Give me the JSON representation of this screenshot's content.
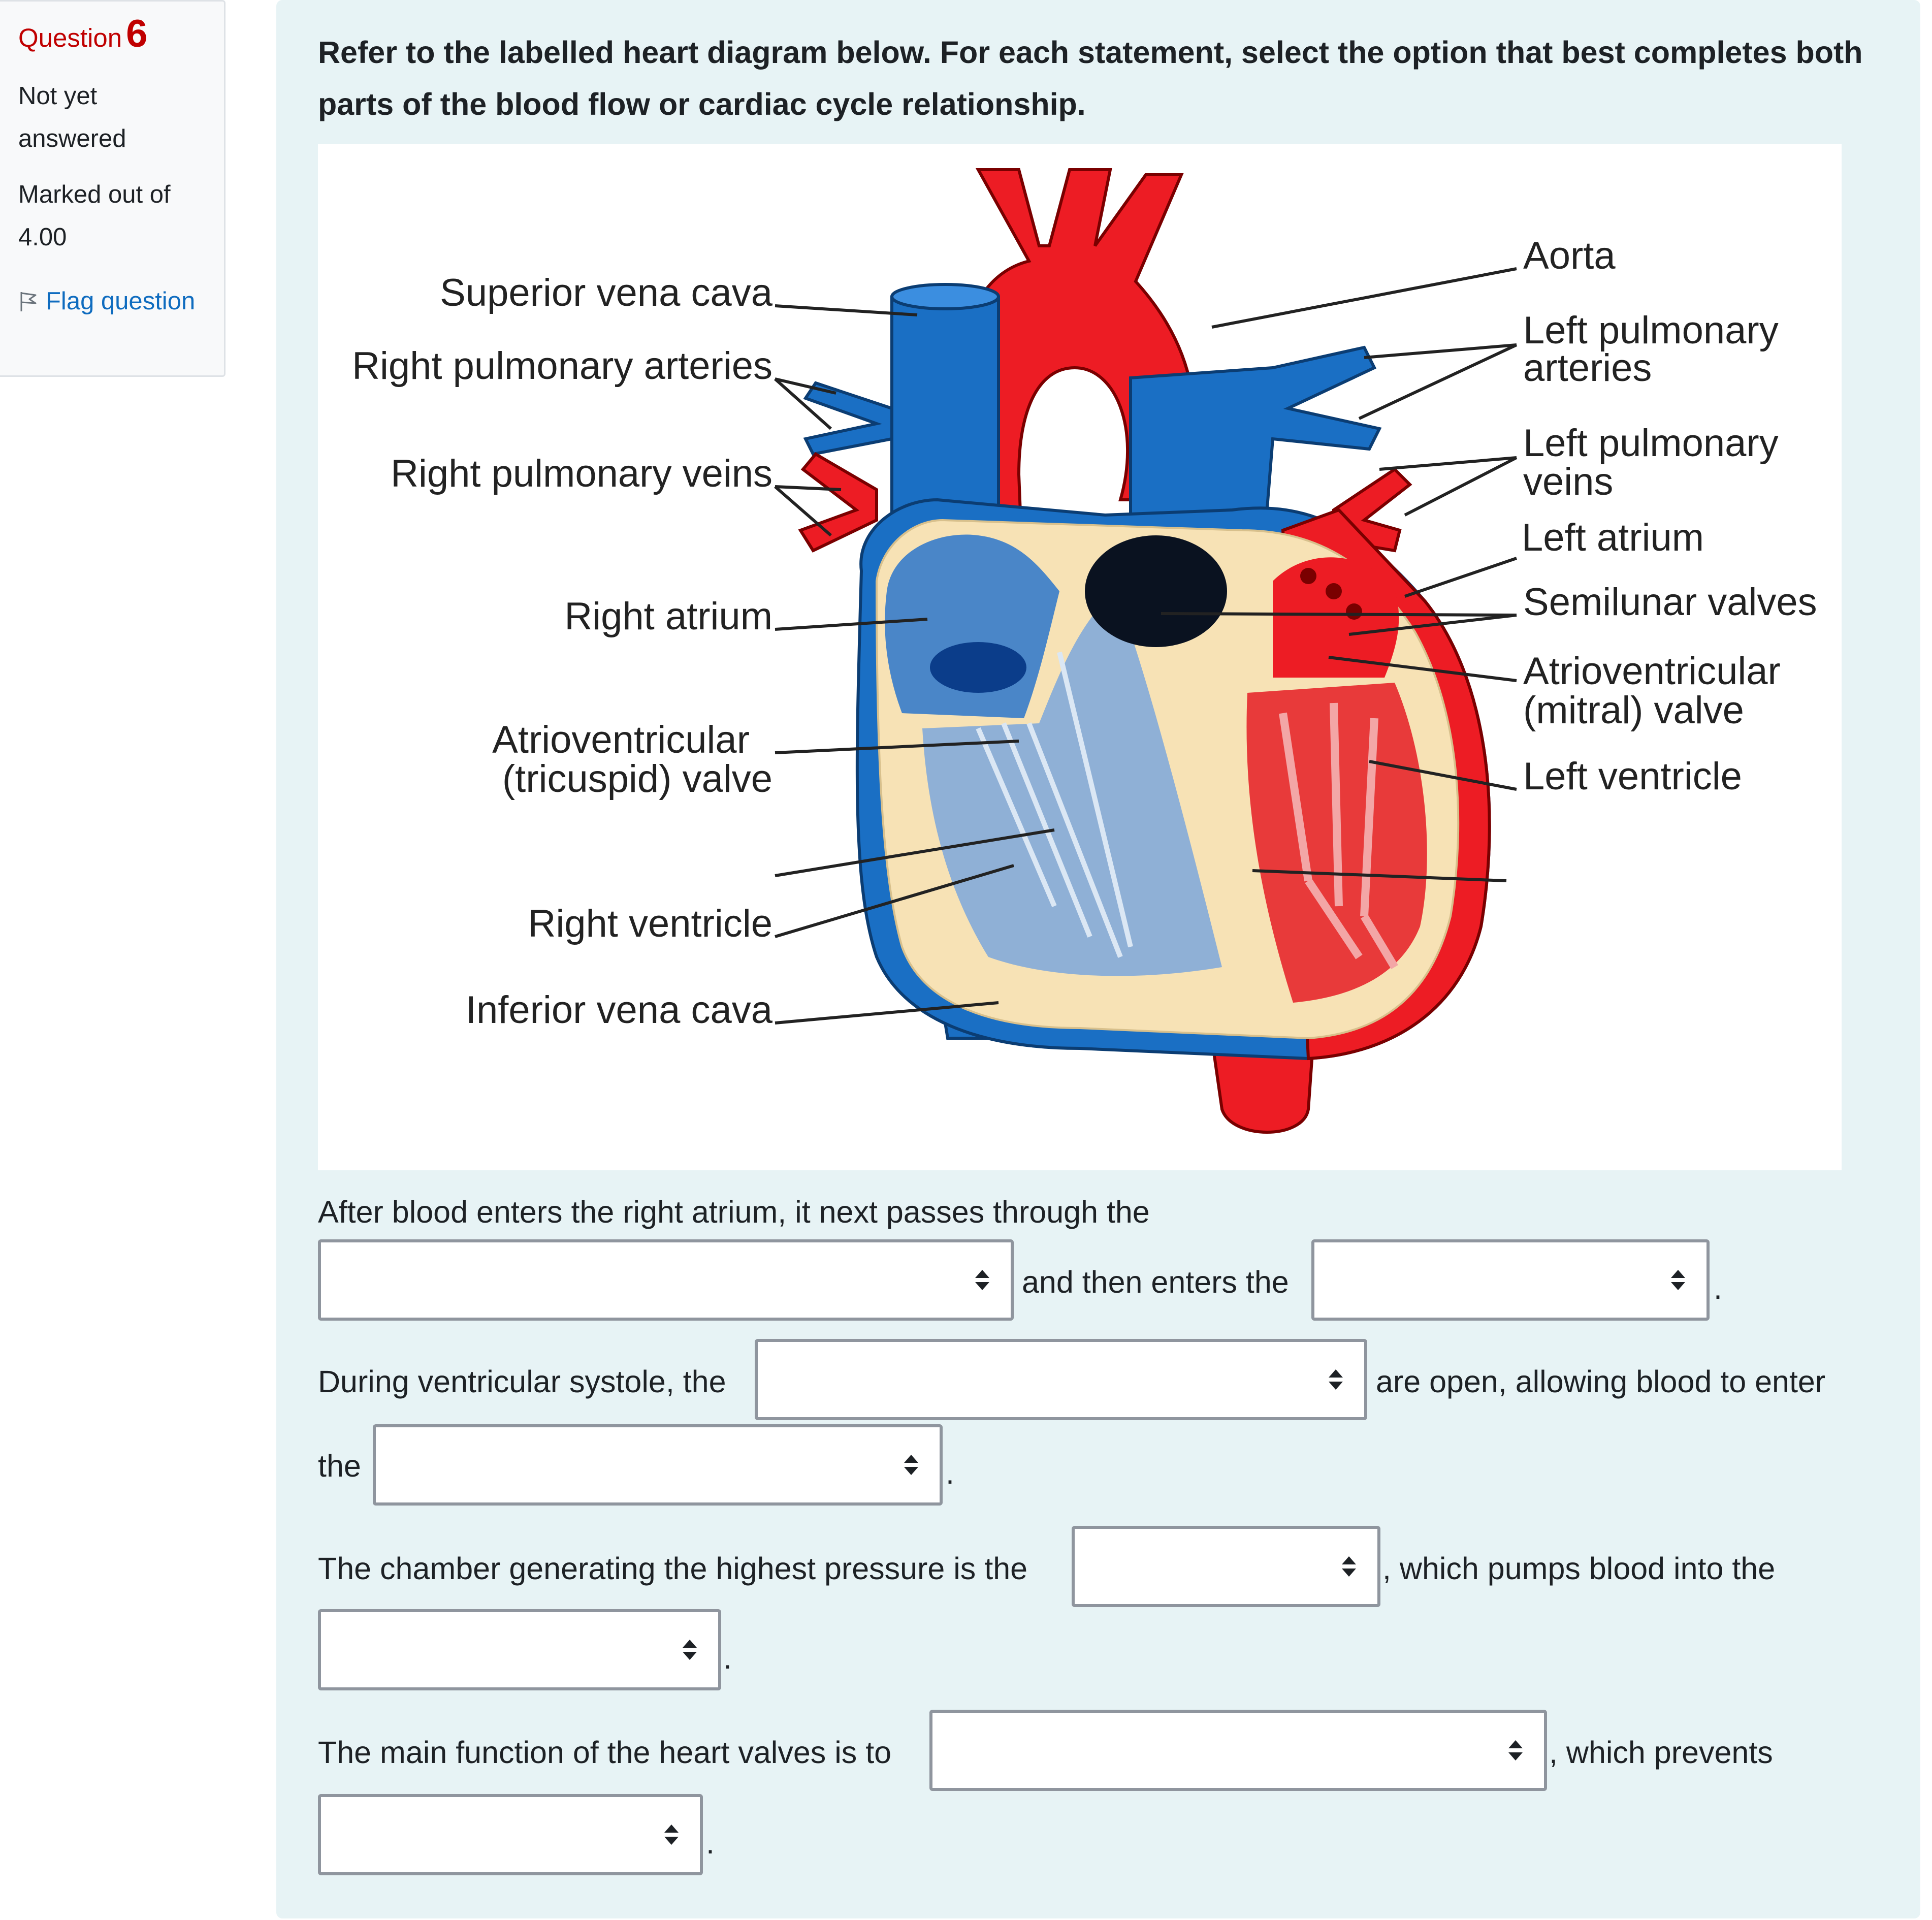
{
  "info": {
    "question_label": "Question",
    "question_number": "6",
    "state": "Not yet answered",
    "grade": "Marked out of 4.00",
    "flag_label": "Flag question"
  },
  "question_text": "Refer to the labelled heart diagram below. For each statement, select the option that best completes both parts of the blood flow or cardiac cycle relationship.",
  "diagram": {
    "labels": {
      "superior_vena_cava": "Superior vena cava",
      "right_pulmonary_arteries": "Right pulmonary arteries",
      "right_pulmonary_veins": "Right pulmonary veins",
      "right_atrium": "Right atrium",
      "av_tricuspid_1": "Atrioventricular",
      "av_tricuspid_2": "(tricuspid) valve",
      "right_ventricle": "Right ventricle",
      "inferior_vena_cava": "Inferior vena cava",
      "aorta": "Aorta",
      "left_pulmonary_arteries_1": "Left pulmonary",
      "left_pulmonary_arteries_2": "arteries",
      "left_pulmonary_veins_1": "Left pulmonary",
      "left_pulmonary_veins_2": "veins",
      "left_atrium": "Left atrium",
      "semilunar_valves": "Semilunar valves",
      "av_mitral_1": "Atrioventricular",
      "av_mitral_2": "(mitral) valve",
      "left_ventricle": "Left ventricle"
    }
  },
  "statements": {
    "s1_a": "After blood enters the right atrium, it next passes through the",
    "s1_b": "and then enters the",
    "s1_end": ".",
    "s2_a": "During ventricular systole, the",
    "s2_b": "are open, allowing blood to enter",
    "s2_c": "the",
    "s2_end": ".",
    "s3_a": "The chamber generating the highest pressure is the",
    "s3_b": ", which pumps blood into the",
    "s3_end": ".",
    "s4_a": "The main function of the heart valves is to",
    "s4_b": ", which prevents",
    "s4_end": "."
  },
  "selects": {
    "s1_first": "",
    "s1_second": "",
    "s2_first": "",
    "s2_second": "",
    "s3_first": "",
    "s3_second": "",
    "s4_first": "",
    "s4_second": ""
  },
  "colors": {
    "question_red": "#c00000",
    "link_blue": "#0f6cbf",
    "panel_bg": "#e7f3f5",
    "artery_red": "#ed1c24",
    "vein_blue": "#1a6fc4",
    "muscle": "#f7e2b5"
  }
}
